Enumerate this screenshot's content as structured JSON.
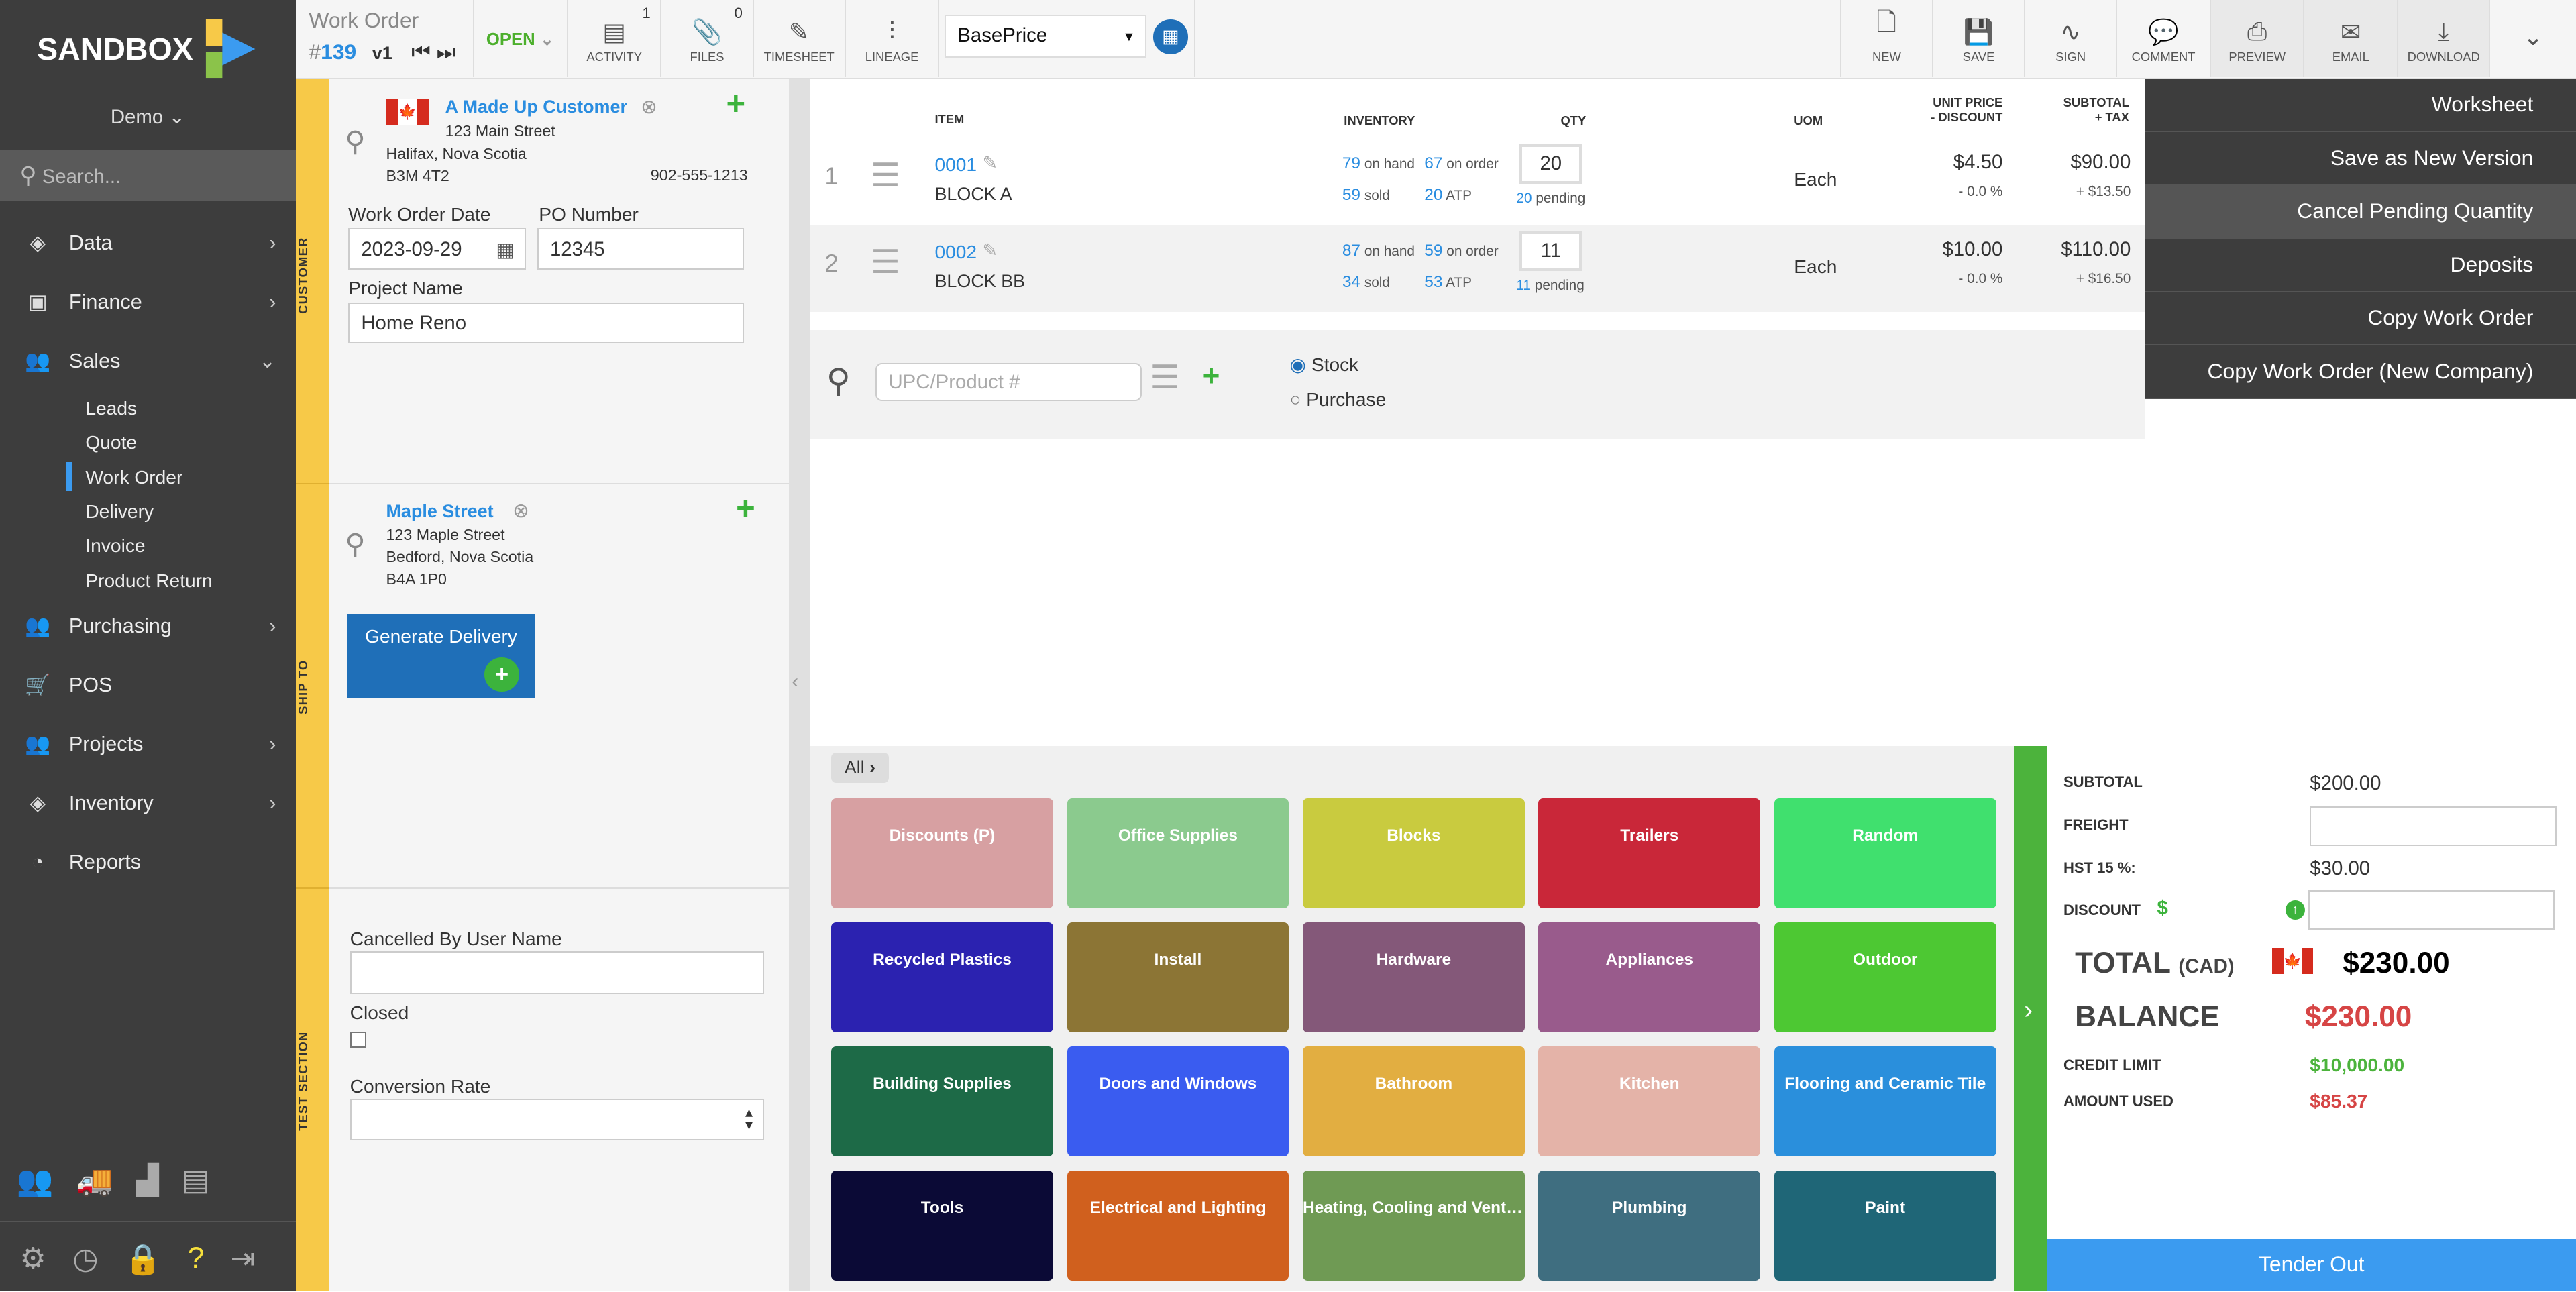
{
  "sidebar": {
    "brand": "SANDBOX",
    "account": "Demo",
    "search_placeholder": "Search...",
    "items": [
      {
        "label": "Data",
        "icon": "cube-icon"
      },
      {
        "label": "Finance",
        "icon": "money-icon"
      },
      {
        "label": "Sales",
        "icon": "users-icon"
      },
      {
        "label": "Purchasing",
        "icon": "users-icon"
      },
      {
        "label": "POS",
        "icon": "cart-icon"
      },
      {
        "label": "Projects",
        "icon": "users-icon"
      },
      {
        "label": "Inventory",
        "icon": "cubes-icon"
      },
      {
        "label": "Reports",
        "icon": "pie-chart-icon"
      }
    ],
    "sales_sub": [
      "Leads",
      "Quote",
      "Work Order",
      "Delivery",
      "Invoice",
      "Product Return"
    ],
    "active_sub": "Work Order"
  },
  "header": {
    "doc_type": "Work Order",
    "number_prefix": "#",
    "number": "139",
    "version": "v1",
    "status": "OPEN",
    "tools": [
      {
        "label": "ACTIVITY",
        "badge": "1"
      },
      {
        "label": "FILES",
        "badge": "0"
      },
      {
        "label": "TIMESHEET"
      },
      {
        "label": "LINEAGE"
      }
    ],
    "price_list": "BasePrice",
    "actions": [
      {
        "label": "NEW"
      },
      {
        "label": "SAVE"
      },
      {
        "label": "SIGN"
      },
      {
        "label": "COMMENT"
      },
      {
        "label": "PREVIEW"
      },
      {
        "label": "EMAIL"
      },
      {
        "label": "DOWNLOAD"
      }
    ]
  },
  "dropdown_menu": [
    "Worksheet",
    "Save as New Version",
    "Cancel Pending Quantity",
    "Deposits",
    "Copy Work Order",
    "Copy Work Order (New Company)"
  ],
  "customer": {
    "section_label": "CUSTOMER",
    "name": "A Made Up Customer",
    "street": "123 Main Street",
    "city": "Halifax, Nova Scotia",
    "postal": "B3M 4T2",
    "phone": "902-555-1213",
    "wo_date_label": "Work Order Date",
    "wo_date": "2023-09-29",
    "po_label": "PO Number",
    "po": "12345",
    "project_label": "Project Name",
    "project": "Home Reno"
  },
  "ship_to": {
    "section_label": "SHIP TO",
    "name": "Maple Street",
    "street": "123 Maple Street",
    "city": "Bedford, Nova Scotia",
    "postal": "B4A 1P0",
    "generate_label": "Generate Delivery"
  },
  "test_section": {
    "section_label": "TEST SECTION",
    "cancelled_label": "Cancelled By User Name",
    "cancelled_value": "",
    "closed_label": "Closed",
    "closed": false,
    "conversion_label": "Conversion Rate",
    "conversion_value": ""
  },
  "lines": {
    "headers": {
      "item": "ITEM",
      "inventory": "INVENTORY",
      "qty": "QTY",
      "uom": "UOM",
      "unit1": "UNIT PRICE",
      "unit2": "- DISCOUNT",
      "sub1": "SUBTOTAL",
      "sub2": "+ TAX"
    },
    "rows": [
      {
        "n": "1",
        "code": "0001",
        "name": "BLOCK A",
        "on_hand": "79",
        "on_order": "67",
        "sold": "59",
        "atp": "20",
        "qty": "20",
        "pending": "20",
        "uom": "Each",
        "price": "$4.50",
        "discount": "- 0.0 %",
        "subtotal": "$90.00",
        "tax": "+ $13.50"
      },
      {
        "n": "2",
        "code": "0002",
        "name": "BLOCK BB",
        "on_hand": "87",
        "on_order": "59",
        "sold": "34",
        "atp": "53",
        "qty": "11",
        "pending": "11",
        "uom": "Each",
        "price": "$10.00",
        "discount": "- 0.0 %",
        "subtotal": "$110.00",
        "tax": "+ $16.50"
      }
    ],
    "words": {
      "on_hand": "on hand",
      "on_order": "on order",
      "sold": "sold",
      "atp": "ATP",
      "pending": "pending"
    }
  },
  "add_line": {
    "placeholder": "UPC/Product #",
    "opt_stock": "Stock",
    "opt_purchase": "Purchase",
    "selected": "Stock"
  },
  "categories": {
    "filter": "All",
    "tiles": [
      {
        "label": "Discounts (P)",
        "color": "#d7a0a2"
      },
      {
        "label": "Office Supplies",
        "color": "#8bca8e"
      },
      {
        "label": "Blocks",
        "color": "#c9cb3f"
      },
      {
        "label": "Trailers",
        "color": "#c92739"
      },
      {
        "label": "Random",
        "color": "#40e06e"
      },
      {
        "label": "Recycled Plastics",
        "color": "#2b22b0"
      },
      {
        "label": "Install",
        "color": "#8c7535"
      },
      {
        "label": "Hardware",
        "color": "#845879"
      },
      {
        "label": "Appliances",
        "color": "#995b8c"
      },
      {
        "label": "Outdoor",
        "color": "#4dc833"
      },
      {
        "label": "Building Supplies",
        "color": "#1d6a47"
      },
      {
        "label": "Doors and Windows",
        "color": "#3a5cf0"
      },
      {
        "label": "Bathroom",
        "color": "#e2ae41"
      },
      {
        "label": "Kitchen",
        "color": "#e4b3a8"
      },
      {
        "label": "Flooring and Ceramic Tile",
        "color": "#2a8fdc"
      },
      {
        "label": "Tools",
        "color": "#0b0a36"
      },
      {
        "label": "Electrical and Lighting",
        "color": "#d0601e"
      },
      {
        "label": "Heating, Cooling and Ventil...",
        "color": "#6f9a54"
      },
      {
        "label": "Plumbing",
        "color": "#3f6e80"
      },
      {
        "label": "Paint",
        "color": "#1f6677"
      }
    ]
  },
  "totals": {
    "subtotal_label": "SUBTOTAL",
    "subtotal": "$200.00",
    "freight_label": "FREIGHT",
    "freight": "",
    "tax_label": "HST 15 %:",
    "tax": "$30.00",
    "discount_label": "DISCOUNT",
    "discount_symbol": "$",
    "discount": "",
    "total_label": "TOTAL",
    "currency": "(CAD)",
    "total": "$230.00",
    "balance_label": "BALANCE",
    "balance": "$230.00",
    "credit_label": "CREDIT LIMIT",
    "credit": "$10,000.00",
    "used_label": "AMOUNT USED",
    "used": "$85.37",
    "tender_label": "Tender Out"
  }
}
